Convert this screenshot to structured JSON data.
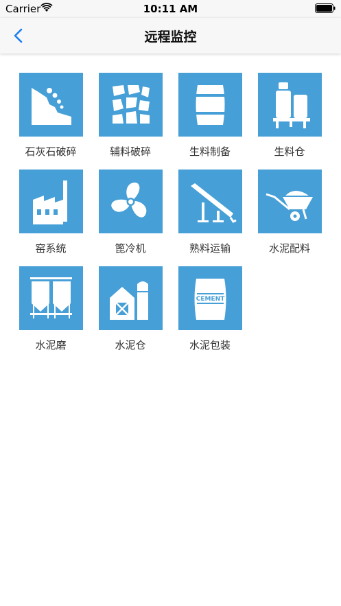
{
  "status_bar": {
    "carrier": "Carrier",
    "time": "10:11 AM"
  },
  "nav": {
    "title": "远程监控"
  },
  "tiles": [
    {
      "label": "石灰石破碎",
      "icon": "crusher-icon"
    },
    {
      "label": "辅料破碎",
      "icon": "stones-icon"
    },
    {
      "label": "生料制备",
      "icon": "barrel-icon"
    },
    {
      "label": "生料仓",
      "icon": "silo-tanks-icon"
    },
    {
      "label": "窑系统",
      "icon": "factory-icon"
    },
    {
      "label": "篦冷机",
      "icon": "fan-icon"
    },
    {
      "label": "熟料运输",
      "icon": "conveyor-icon"
    },
    {
      "label": "水泥配料",
      "icon": "wheelbarrow-icon"
    },
    {
      "label": "水泥磨",
      "icon": "twin-silo-icon"
    },
    {
      "label": "水泥仓",
      "icon": "barn-silo-icon"
    },
    {
      "label": "水泥包装",
      "icon": "cement-bag-icon",
      "bag_text": "CEMENT"
    }
  ]
}
